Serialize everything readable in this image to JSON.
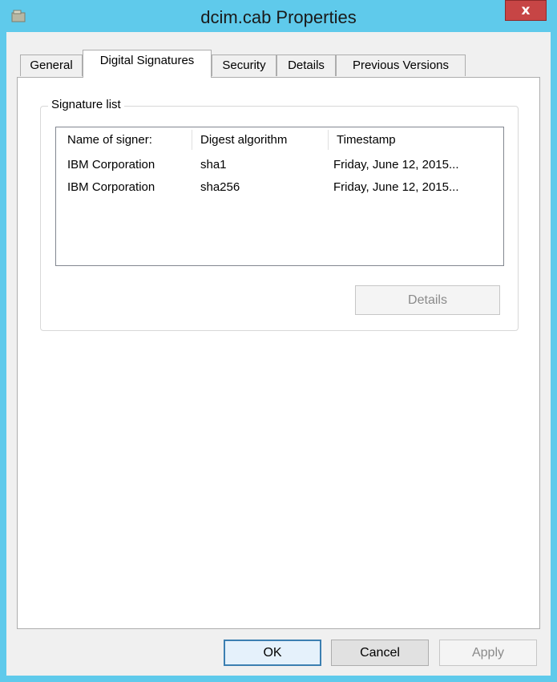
{
  "window": {
    "title": "dcim.cab Properties"
  },
  "tabs": [
    {
      "label": "General"
    },
    {
      "label": "Digital Signatures"
    },
    {
      "label": "Security"
    },
    {
      "label": "Details"
    },
    {
      "label": "Previous Versions"
    }
  ],
  "signature_group": {
    "label": "Signature list",
    "columns": [
      "Name of signer:",
      "Digest algorithm",
      "Timestamp"
    ],
    "rows": [
      {
        "signer": "IBM Corporation",
        "digest": "sha1",
        "timestamp": "Friday, June 12, 2015..."
      },
      {
        "signer": "IBM Corporation",
        "digest": "sha256",
        "timestamp": "Friday, June 12, 2015..."
      }
    ],
    "details_button": "Details"
  },
  "footer": {
    "ok": "OK",
    "cancel": "Cancel",
    "apply": "Apply"
  },
  "colors": {
    "titlebar": "#5fcaeb",
    "close": "#c74545"
  }
}
